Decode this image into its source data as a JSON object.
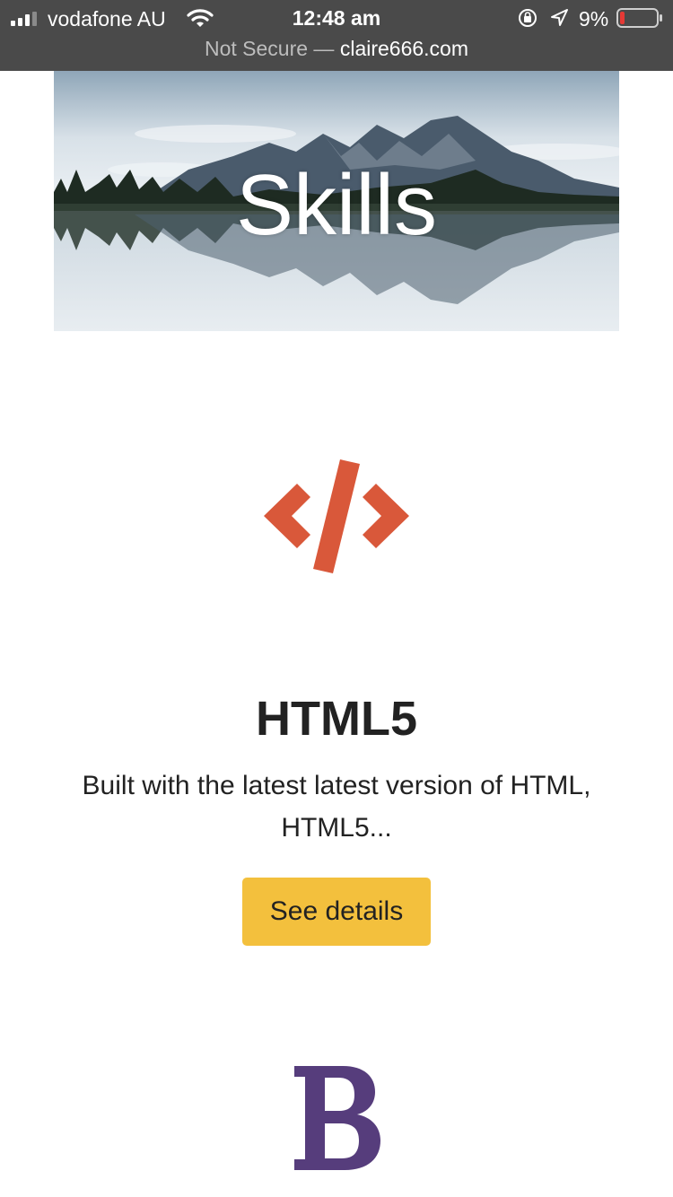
{
  "status_bar": {
    "carrier": "vodafone AU",
    "time": "12:48 am",
    "battery_percent": "9%",
    "battery_level": 0.09,
    "icons": [
      "signal-icon",
      "wifi-icon",
      "rotation-lock-icon",
      "location-arrow-icon",
      "battery-icon"
    ]
  },
  "address_bar": {
    "security_label": "Not Secure —",
    "domain": "claire666.com"
  },
  "hero": {
    "title": "Skills"
  },
  "features": [
    {
      "icon": "code-icon",
      "title": "HTML5",
      "description": "Built with the latest latest version of HTML, HTML5...",
      "button_label": "See details"
    },
    {
      "icon": "bootstrap-icon"
    }
  ],
  "colors": {
    "accent_button": "#f3c03d",
    "code_icon": "#d9583a",
    "bootstrap_icon": "#563d7c",
    "topbar": "#4a4a4a",
    "battery_low": "#e53935"
  }
}
